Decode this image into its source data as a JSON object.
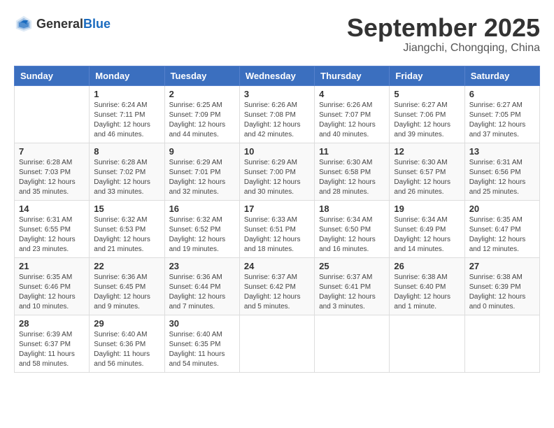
{
  "header": {
    "logo_general": "General",
    "logo_blue": "Blue",
    "month": "September 2025",
    "location": "Jiangchi, Chongqing, China"
  },
  "weekdays": [
    "Sunday",
    "Monday",
    "Tuesday",
    "Wednesday",
    "Thursday",
    "Friday",
    "Saturday"
  ],
  "weeks": [
    [
      {
        "day": "",
        "info": ""
      },
      {
        "day": "1",
        "info": "Sunrise: 6:24 AM\nSunset: 7:11 PM\nDaylight: 12 hours\nand 46 minutes."
      },
      {
        "day": "2",
        "info": "Sunrise: 6:25 AM\nSunset: 7:09 PM\nDaylight: 12 hours\nand 44 minutes."
      },
      {
        "day": "3",
        "info": "Sunrise: 6:26 AM\nSunset: 7:08 PM\nDaylight: 12 hours\nand 42 minutes."
      },
      {
        "day": "4",
        "info": "Sunrise: 6:26 AM\nSunset: 7:07 PM\nDaylight: 12 hours\nand 40 minutes."
      },
      {
        "day": "5",
        "info": "Sunrise: 6:27 AM\nSunset: 7:06 PM\nDaylight: 12 hours\nand 39 minutes."
      },
      {
        "day": "6",
        "info": "Sunrise: 6:27 AM\nSunset: 7:05 PM\nDaylight: 12 hours\nand 37 minutes."
      }
    ],
    [
      {
        "day": "7",
        "info": "Sunrise: 6:28 AM\nSunset: 7:03 PM\nDaylight: 12 hours\nand 35 minutes."
      },
      {
        "day": "8",
        "info": "Sunrise: 6:28 AM\nSunset: 7:02 PM\nDaylight: 12 hours\nand 33 minutes."
      },
      {
        "day": "9",
        "info": "Sunrise: 6:29 AM\nSunset: 7:01 PM\nDaylight: 12 hours\nand 32 minutes."
      },
      {
        "day": "10",
        "info": "Sunrise: 6:29 AM\nSunset: 7:00 PM\nDaylight: 12 hours\nand 30 minutes."
      },
      {
        "day": "11",
        "info": "Sunrise: 6:30 AM\nSunset: 6:58 PM\nDaylight: 12 hours\nand 28 minutes."
      },
      {
        "day": "12",
        "info": "Sunrise: 6:30 AM\nSunset: 6:57 PM\nDaylight: 12 hours\nand 26 minutes."
      },
      {
        "day": "13",
        "info": "Sunrise: 6:31 AM\nSunset: 6:56 PM\nDaylight: 12 hours\nand 25 minutes."
      }
    ],
    [
      {
        "day": "14",
        "info": "Sunrise: 6:31 AM\nSunset: 6:55 PM\nDaylight: 12 hours\nand 23 minutes."
      },
      {
        "day": "15",
        "info": "Sunrise: 6:32 AM\nSunset: 6:53 PM\nDaylight: 12 hours\nand 21 minutes."
      },
      {
        "day": "16",
        "info": "Sunrise: 6:32 AM\nSunset: 6:52 PM\nDaylight: 12 hours\nand 19 minutes."
      },
      {
        "day": "17",
        "info": "Sunrise: 6:33 AM\nSunset: 6:51 PM\nDaylight: 12 hours\nand 18 minutes."
      },
      {
        "day": "18",
        "info": "Sunrise: 6:34 AM\nSunset: 6:50 PM\nDaylight: 12 hours\nand 16 minutes."
      },
      {
        "day": "19",
        "info": "Sunrise: 6:34 AM\nSunset: 6:49 PM\nDaylight: 12 hours\nand 14 minutes."
      },
      {
        "day": "20",
        "info": "Sunrise: 6:35 AM\nSunset: 6:47 PM\nDaylight: 12 hours\nand 12 minutes."
      }
    ],
    [
      {
        "day": "21",
        "info": "Sunrise: 6:35 AM\nSunset: 6:46 PM\nDaylight: 12 hours\nand 10 minutes."
      },
      {
        "day": "22",
        "info": "Sunrise: 6:36 AM\nSunset: 6:45 PM\nDaylight: 12 hours\nand 9 minutes."
      },
      {
        "day": "23",
        "info": "Sunrise: 6:36 AM\nSunset: 6:44 PM\nDaylight: 12 hours\nand 7 minutes."
      },
      {
        "day": "24",
        "info": "Sunrise: 6:37 AM\nSunset: 6:42 PM\nDaylight: 12 hours\nand 5 minutes."
      },
      {
        "day": "25",
        "info": "Sunrise: 6:37 AM\nSunset: 6:41 PM\nDaylight: 12 hours\nand 3 minutes."
      },
      {
        "day": "26",
        "info": "Sunrise: 6:38 AM\nSunset: 6:40 PM\nDaylight: 12 hours\nand 1 minute."
      },
      {
        "day": "27",
        "info": "Sunrise: 6:38 AM\nSunset: 6:39 PM\nDaylight: 12 hours\nand 0 minutes."
      }
    ],
    [
      {
        "day": "28",
        "info": "Sunrise: 6:39 AM\nSunset: 6:37 PM\nDaylight: 11 hours\nand 58 minutes."
      },
      {
        "day": "29",
        "info": "Sunrise: 6:40 AM\nSunset: 6:36 PM\nDaylight: 11 hours\nand 56 minutes."
      },
      {
        "day": "30",
        "info": "Sunrise: 6:40 AM\nSunset: 6:35 PM\nDaylight: 11 hours\nand 54 minutes."
      },
      {
        "day": "",
        "info": ""
      },
      {
        "day": "",
        "info": ""
      },
      {
        "day": "",
        "info": ""
      },
      {
        "day": "",
        "info": ""
      }
    ]
  ]
}
